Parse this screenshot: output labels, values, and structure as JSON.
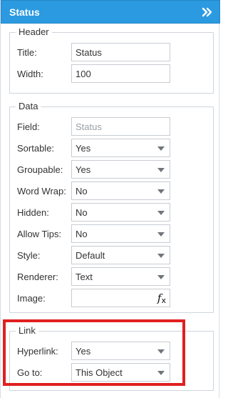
{
  "panel": {
    "title": "Status",
    "collapse_icon": "double-chevron-right-icon",
    "header_color": "#2b9ae0",
    "highlight_color": "#e02020"
  },
  "header_group": {
    "legend": "Header",
    "title_label": "Title:",
    "title_value": "Status",
    "width_label": "Width:",
    "width_value": "100"
  },
  "data_group": {
    "legend": "Data",
    "field_label": "Field:",
    "field_value": "Status",
    "sortable_label": "Sortable:",
    "sortable_value": "Yes",
    "groupable_label": "Groupable:",
    "groupable_value": "Yes",
    "wordwrap_label": "Word Wrap:",
    "wordwrap_value": "No",
    "hidden_label": "Hidden:",
    "hidden_value": "No",
    "allowtips_label": "Allow Tips:",
    "allowtips_value": "No",
    "style_label": "Style:",
    "style_value": "Default",
    "renderer_label": "Renderer:",
    "renderer_value": "Text",
    "image_label": "Image:",
    "image_value": "",
    "image_button_icon": "fx-icon"
  },
  "link_group": {
    "legend": "Link",
    "hyperlink_label": "Hyperlink:",
    "hyperlink_value": "Yes",
    "goto_label": "Go to:",
    "goto_value": "This Object"
  }
}
